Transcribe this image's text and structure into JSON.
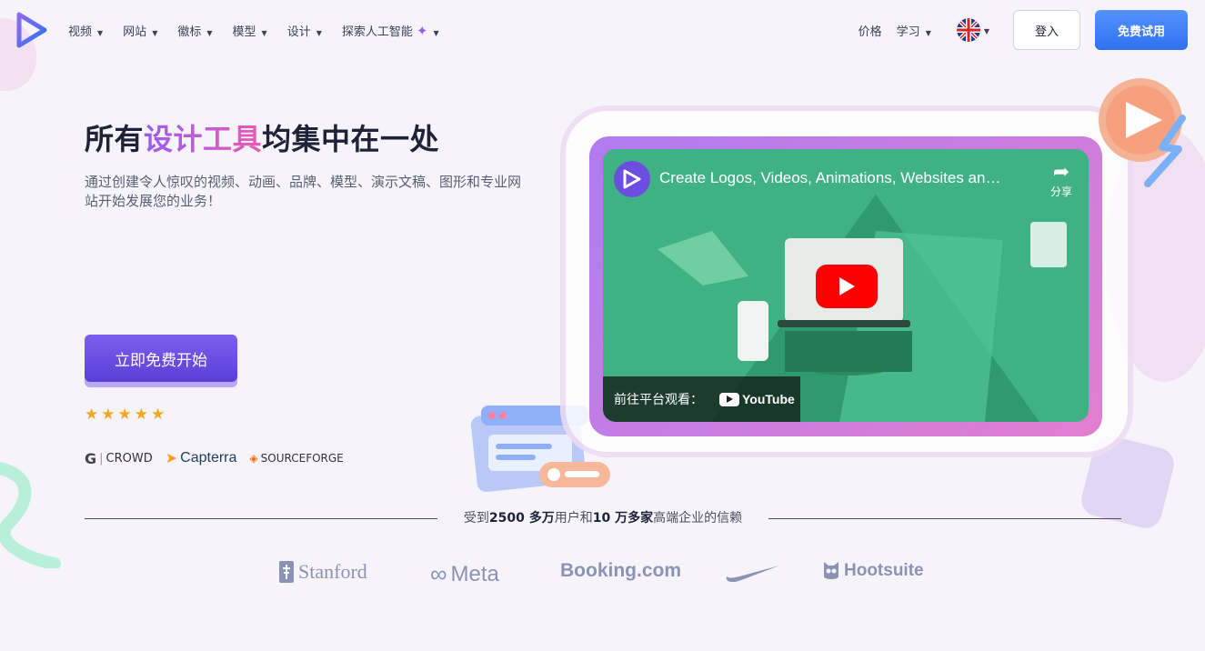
{
  "nav": {
    "items": [
      {
        "label": "视频"
      },
      {
        "label": "网站"
      },
      {
        "label": "徽标"
      },
      {
        "label": "模型"
      },
      {
        "label": "设计"
      },
      {
        "label": "探索人工智能"
      }
    ],
    "pricing": "价格",
    "learn": "学习",
    "login": "登入",
    "trial": "免费试用"
  },
  "hero": {
    "title_pre": "所有",
    "title_highlight": "设计工具",
    "title_post": "均集中在一处",
    "subtitle": "通过创建令人惊叹的视频、动画、品牌、模型、演示文稿、图形和专业网站开始发展您的业务！",
    "cta": "立即免费开始",
    "rating_stars": 5,
    "review_sites": [
      "CROWD",
      "Capterra",
      "SOURCEFORGE"
    ]
  },
  "video": {
    "title": "Create Logos, Videos, Animations, Websites an…",
    "share": "分享",
    "watch_on": "前往平台观看：",
    "platform": "YouTube"
  },
  "trusted": {
    "prefix": "受到",
    "users": "2500 多万",
    "mid": "用户和",
    "companies": "10 万多家",
    "suffix": "高端企业的信赖"
  },
  "brands": [
    "Stanford",
    "Meta",
    "Booking.com",
    "Nike",
    "Hootsuite"
  ],
  "colors": {
    "accent_blue": "#2f72f0",
    "cta_purple": "#5b3fd6",
    "star": "#f5a623"
  }
}
